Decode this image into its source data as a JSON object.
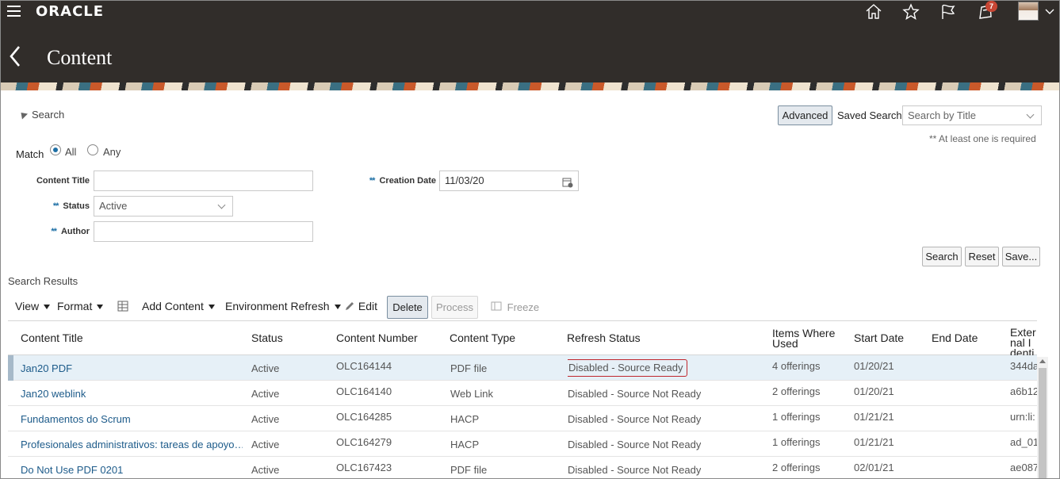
{
  "header": {
    "brand": "ORACLE",
    "notification_count": "7",
    "page_title": "Content"
  },
  "search": {
    "toggle_label": "Search",
    "advanced_label": "Advanced",
    "saved_search_label": "Saved Search",
    "saved_search_placeholder": "Search by Title",
    "required_note": "** At least one is required",
    "match_label": "Match",
    "match_all": "All",
    "match_any": "Any",
    "fields": {
      "content_title_label": "Content Title",
      "content_title_value": "",
      "status_label": "Status",
      "status_value": "Active",
      "author_label": "Author",
      "author_value": "",
      "creation_date_label": "Creation Date",
      "creation_date_value": "11/03/20",
      "required_marker": "**"
    },
    "buttons": {
      "search": "Search",
      "reset": "Reset",
      "save": "Save..."
    }
  },
  "results": {
    "title": "Search Results",
    "toolbar": {
      "view": "View",
      "format": "Format",
      "add_content": "Add Content",
      "environment_refresh": "Environment Refresh",
      "edit": "Edit",
      "delete": "Delete",
      "process": "Process",
      "freeze": "Freeze"
    },
    "columns": {
      "content_title": "Content Title",
      "status": "Status",
      "content_number": "Content Number",
      "content_type": "Content Type",
      "refresh_status": "Refresh Status",
      "items_where_used": "Items Where Used",
      "start_date": "Start Date",
      "end_date": "End Date",
      "external_id": "External Identi"
    },
    "rows": [
      {
        "title": "Jan20 PDF",
        "status": "Active",
        "number": "OLC164144",
        "type": "PDF file",
        "refresh": "Disabled - Source Ready",
        "used": "4 offerings",
        "start": "01/20/21",
        "end": "",
        "ext": "344da"
      },
      {
        "title": "Jan20 weblink",
        "status": "Active",
        "number": "OLC164140",
        "type": "Web Link",
        "refresh": "Disabled - Source Not Ready",
        "used": "2 offerings",
        "start": "01/20/21",
        "end": "",
        "ext": "a6b12"
      },
      {
        "title": "Fundamentos do Scrum",
        "status": "Active",
        "number": "OLC164285",
        "type": "HACP",
        "refresh": "Disabled - Source Not Ready",
        "used": "1 offerings",
        "start": "01/21/21",
        "end": "",
        "ext": "urn:li:"
      },
      {
        "title": "Profesionales administrativos: tareas de apoyo…",
        "status": "Active",
        "number": "OLC164279",
        "type": "HACP",
        "refresh": "Disabled - Source Not Ready",
        "used": "1 offerings",
        "start": "01/21/21",
        "end": "",
        "ext": "ad_01"
      },
      {
        "title": "Do Not Use PDF 0201",
        "status": "Active",
        "number": "OLC167423",
        "type": "PDF file",
        "refresh": "Disabled - Source Not Ready",
        "used": "2 offerings",
        "start": "02/01/21",
        "end": "",
        "ext": "ae087"
      }
    ]
  }
}
